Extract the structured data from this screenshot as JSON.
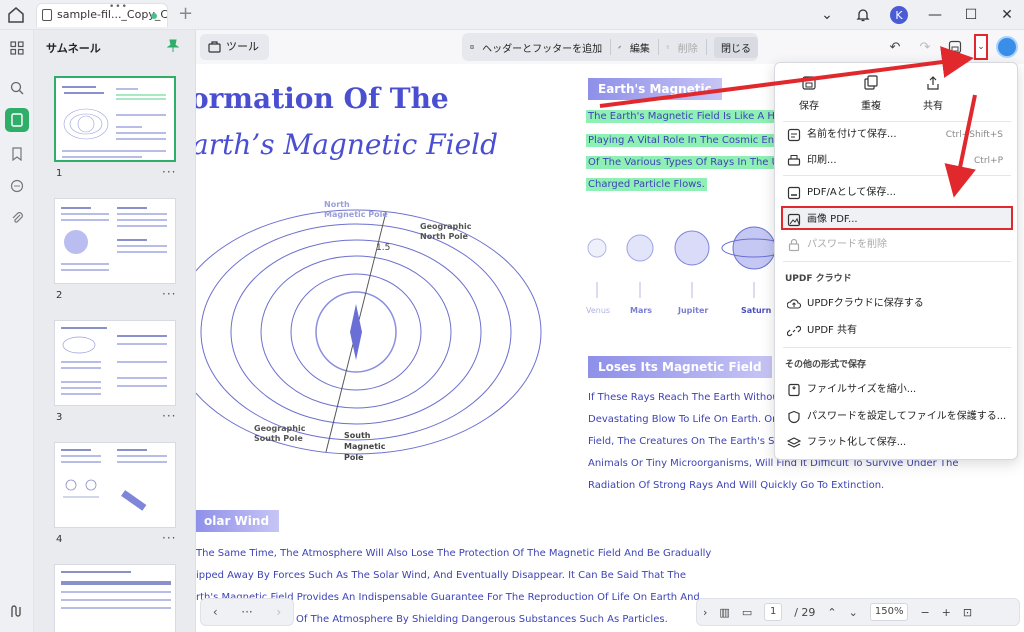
{
  "titlebar": {
    "tab_title": "sample-fil..._Copy_Copy",
    "new_tab": "+",
    "avatar_letter": "K"
  },
  "sidebar": {
    "panel_title": "サムネール",
    "pages": [
      {
        "number": "1",
        "more": "···"
      },
      {
        "number": "2",
        "more": "···"
      },
      {
        "number": "3",
        "more": "···"
      },
      {
        "number": "4",
        "more": "···"
      }
    ]
  },
  "toolbar": {
    "tools_label": "ツール",
    "header_footer_label": "ヘッダーとフッターを追加",
    "edit_label": "編集",
    "delete_label": "削除",
    "close_label": "閉じる"
  },
  "document": {
    "title_line1": "ormation Of The",
    "title_line2": "arth’s Magnetic Field",
    "section1_heading": "Earth's Magnetic",
    "highlighted_lines": [
      "The Earth's Magnetic Field Is Like A Hug",
      "Playing A Vital Role In The Cosmic Envir",
      "Of The Various Types Of Rays In The Un",
      "Charged Particle Flows."
    ],
    "diagram_labels": {
      "north_magnetic": "North\nMagnetic Pole",
      "geo_north": "Geographic\nNorth Pole",
      "geo_south": "Geographic\nSouth Pole",
      "south_magnetic": "South\nMagnetic\nPole",
      "angle": "1.5"
    },
    "planets": [
      "Venus",
      "Mars",
      "Jupiter",
      "Saturn"
    ],
    "section2_heading": "Loses Its Magnetic Field",
    "section2_lines": [
      "If These Rays Reach The Earth Without",
      "Devastating Blow To Life On Earth. Once",
      "Field, The Creatures On The Earth's Sur",
      "Animals Or Tiny Microorganisms, Will Find It Difficult To Survive Under The",
      "Radiation Of Strong Rays And Will Quickly Go To Extinction."
    ],
    "section3_heading": "olar Wind",
    "section3_lines": [
      "The Same Time, The Atmosphere Will Also Lose The Protection Of The Magnetic Field And Be Gradually",
      "ipped Away By Forces Such As The Solar Wind, And Eventually Disappear. It Can Be Said That The",
      "rth's Magnetic Field Provides An Indispensable Guarantee For The Reproduction Of Life On Earth And",
      "Of The Atmosphere By Shielding Dangerous Substances Such As Particles."
    ]
  },
  "menu": {
    "top": {
      "save": "保存",
      "duplicate": "重複",
      "share": "共有"
    },
    "items": {
      "save_as": "名前を付けて保存...",
      "save_as_shortcut": "Ctrl+Shift+S",
      "print": "印刷...",
      "print_shortcut": "Ctrl+P",
      "save_pdfa": "PDF/Aとして保存...",
      "image_pdf": "画像 PDF...",
      "remove_password": "パスワードを削除",
      "cloud_section": "UPDF クラウド",
      "save_cloud": "UPDFクラウドに保存する",
      "updf_share": "UPDF 共有",
      "other_section": "その他の形式で保存",
      "reduce_size": "ファイルサイズを縮小...",
      "protect_password": "パスワードを設定してファイルを保護する...",
      "flatten": "フラット化して保存..."
    }
  },
  "bottom": {
    "page_current": "1",
    "page_total": "/ 29",
    "zoom": "150%",
    "nav_more": "···"
  },
  "colors": {
    "accent_green": "#2fae6a",
    "doc_blue": "#4a4fd2",
    "highlight": "#8ff0b6",
    "annotation_red": "#e0282d"
  }
}
